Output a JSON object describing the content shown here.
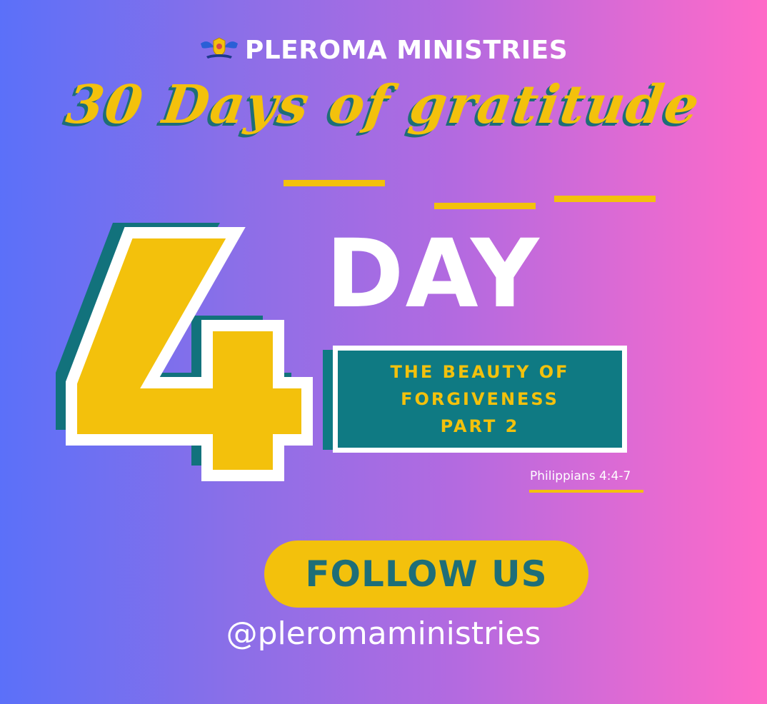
{
  "header": {
    "brand_name": "PLEROMA MINISTRIES",
    "logo_icon": "dove-crest-icon"
  },
  "title_script": "30 Days of gratitude",
  "day": {
    "number": "4",
    "label": "DAY"
  },
  "topic": {
    "lines": [
      "THE BEAUTY OF",
      "FORGIVENESS",
      "PART 2"
    ]
  },
  "verse": "Philippians 4:4-7",
  "cta": {
    "button_label": "FOLLOW US",
    "handle": "@pleromaministries"
  },
  "colors": {
    "accent_yellow": "#f3c10c",
    "teal": "#0f7a83",
    "white": "#ffffff",
    "gradient_left": "#5b70f9",
    "gradient_right": "#ff6ac7"
  }
}
